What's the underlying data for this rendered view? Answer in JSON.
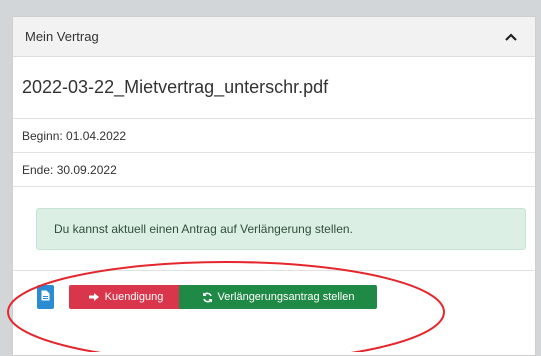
{
  "card": {
    "title": "Mein Vertrag",
    "filename": "2022-03-22_Mietvertrag_unterschr.pdf",
    "begin": "Beginn: 01.04.2022",
    "end": "Ende: 30.09.2022",
    "alert": "Du kannst aktuell einen Antrag auf Verlängerung stellen."
  },
  "buttons": {
    "kuendigung": "Kuendigung",
    "verlaengerung": "Verlängerungsantrag stellen"
  },
  "icons": {
    "collapse": "chevron-up-icon",
    "document": "document-icon",
    "signout": "sign-out-icon",
    "refresh": "refresh-icon"
  },
  "colors": {
    "doc_button": "#2b8bd3",
    "kuendigung_button": "#d9354b",
    "verlaengerung_button": "#1f8a45",
    "alert_bg": "#dcefe4",
    "annotation_ellipse": "#e5262d"
  }
}
